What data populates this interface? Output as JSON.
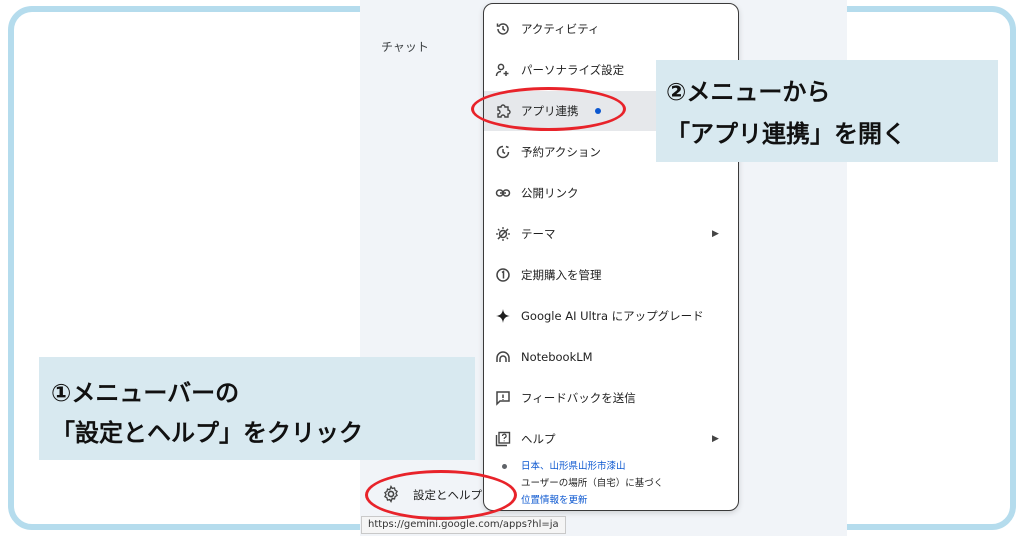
{
  "sidebar": {
    "chat_label": "チャット",
    "settings_label": "設定とヘルプ"
  },
  "status_url": "https://gemini.google.com/apps?hl=ja",
  "menu": {
    "items": [
      {
        "label": "アクティビティ",
        "icon": "history-icon"
      },
      {
        "label": "パーソナライズ設定",
        "icon": "person-settings-icon"
      },
      {
        "label": "アプリ連携",
        "icon": "puzzle-icon",
        "has_dot": true
      },
      {
        "label": "予約アクション",
        "icon": "scheduled-icon"
      },
      {
        "label": "公開リンク",
        "icon": "link-icon"
      },
      {
        "label": "テーマ",
        "icon": "theme-icon",
        "submenu": true
      },
      {
        "label": "定期購入を管理",
        "icon": "subscription-icon"
      },
      {
        "label": "Google AI Ultra にアップグレード",
        "icon": "sparkle-icon"
      },
      {
        "label": "NotebookLM",
        "icon": "notebooklm-icon"
      },
      {
        "label": "フィードバックを送信",
        "icon": "feedback-icon"
      },
      {
        "label": "ヘルプ",
        "icon": "help-icon",
        "submenu": true
      }
    ],
    "location": {
      "place": "日本、山形県山形市漆山",
      "basis": "ユーザーの場所（自宅）に基づく",
      "update_link": "位置情報を更新"
    }
  },
  "callouts": {
    "step1_line1": "①メニューバーの",
    "step1_line2": "「設定とヘルプ」をクリック",
    "step2_line1": "②メニューから",
    "step2_line2": "「アプリ連携」を開く"
  },
  "colors": {
    "accent": "#0b57d0",
    "highlight_oval": "#e8232a",
    "callout_bg": "#d8e9f0",
    "frame_border": "#b5dced"
  }
}
